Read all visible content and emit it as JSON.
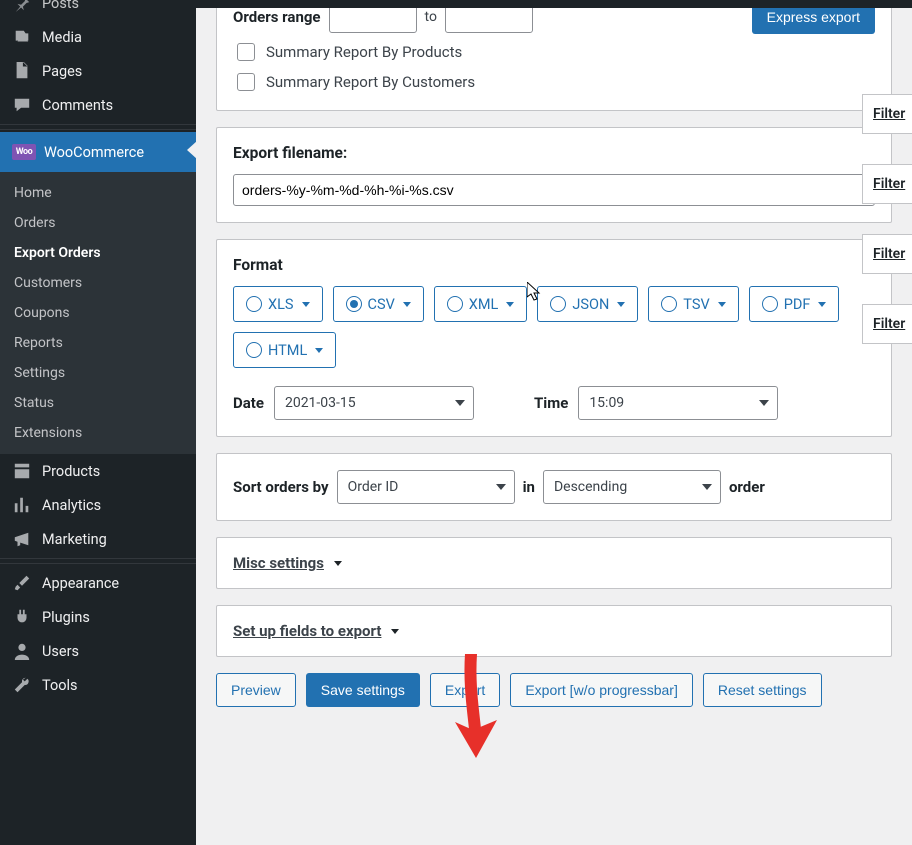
{
  "sidebar": {
    "items": [
      {
        "label": "Posts",
        "icon": "pin"
      },
      {
        "label": "Media",
        "icon": "media"
      },
      {
        "label": "Pages",
        "icon": "page"
      },
      {
        "label": "Comments",
        "icon": "comment"
      }
    ],
    "woo_label": "WooCommerce",
    "woo_sub": [
      {
        "label": "Home"
      },
      {
        "label": "Orders"
      },
      {
        "label": "Export Orders",
        "active": true
      },
      {
        "label": "Customers"
      },
      {
        "label": "Coupons"
      },
      {
        "label": "Reports"
      },
      {
        "label": "Settings"
      },
      {
        "label": "Status"
      },
      {
        "label": "Extensions"
      }
    ],
    "after": [
      {
        "label": "Products",
        "icon": "products"
      },
      {
        "label": "Analytics",
        "icon": "analytics"
      },
      {
        "label": "Marketing",
        "icon": "marketing"
      }
    ],
    "tail": [
      {
        "label": "Appearance",
        "icon": "brush"
      },
      {
        "label": "Plugins",
        "icon": "plug"
      },
      {
        "label": "Users",
        "icon": "user"
      },
      {
        "label": "Tools",
        "icon": "wrench"
      }
    ],
    "woo_badge": "Woo"
  },
  "orders_range": {
    "label": "Orders range",
    "to": "to",
    "express": "Express export"
  },
  "summary": {
    "products": "Summary Report By Products",
    "customers": "Summary Report By Customers"
  },
  "filename": {
    "label": "Export filename:",
    "value": "orders-%y-%m-%d-%h-%i-%s.csv"
  },
  "format": {
    "label": "Format",
    "opts": [
      "XLS",
      "CSV",
      "XML",
      "JSON",
      "TSV",
      "PDF",
      "HTML"
    ],
    "selected": "CSV",
    "date_label": "Date",
    "date_value": "2021-03-15",
    "time_label": "Time",
    "time_value": "15:09"
  },
  "sort": {
    "label": "Sort orders by",
    "field": "Order ID",
    "in": "in",
    "dir": "Descending",
    "order": "order"
  },
  "misc_label": "Misc settings",
  "setup_label": "Set up fields to export",
  "actions": {
    "preview": "Preview",
    "save": "Save settings",
    "export": "Export",
    "export_wo": "Export [w/o progressbar]",
    "reset": "Reset settings"
  },
  "filter": "Filter"
}
